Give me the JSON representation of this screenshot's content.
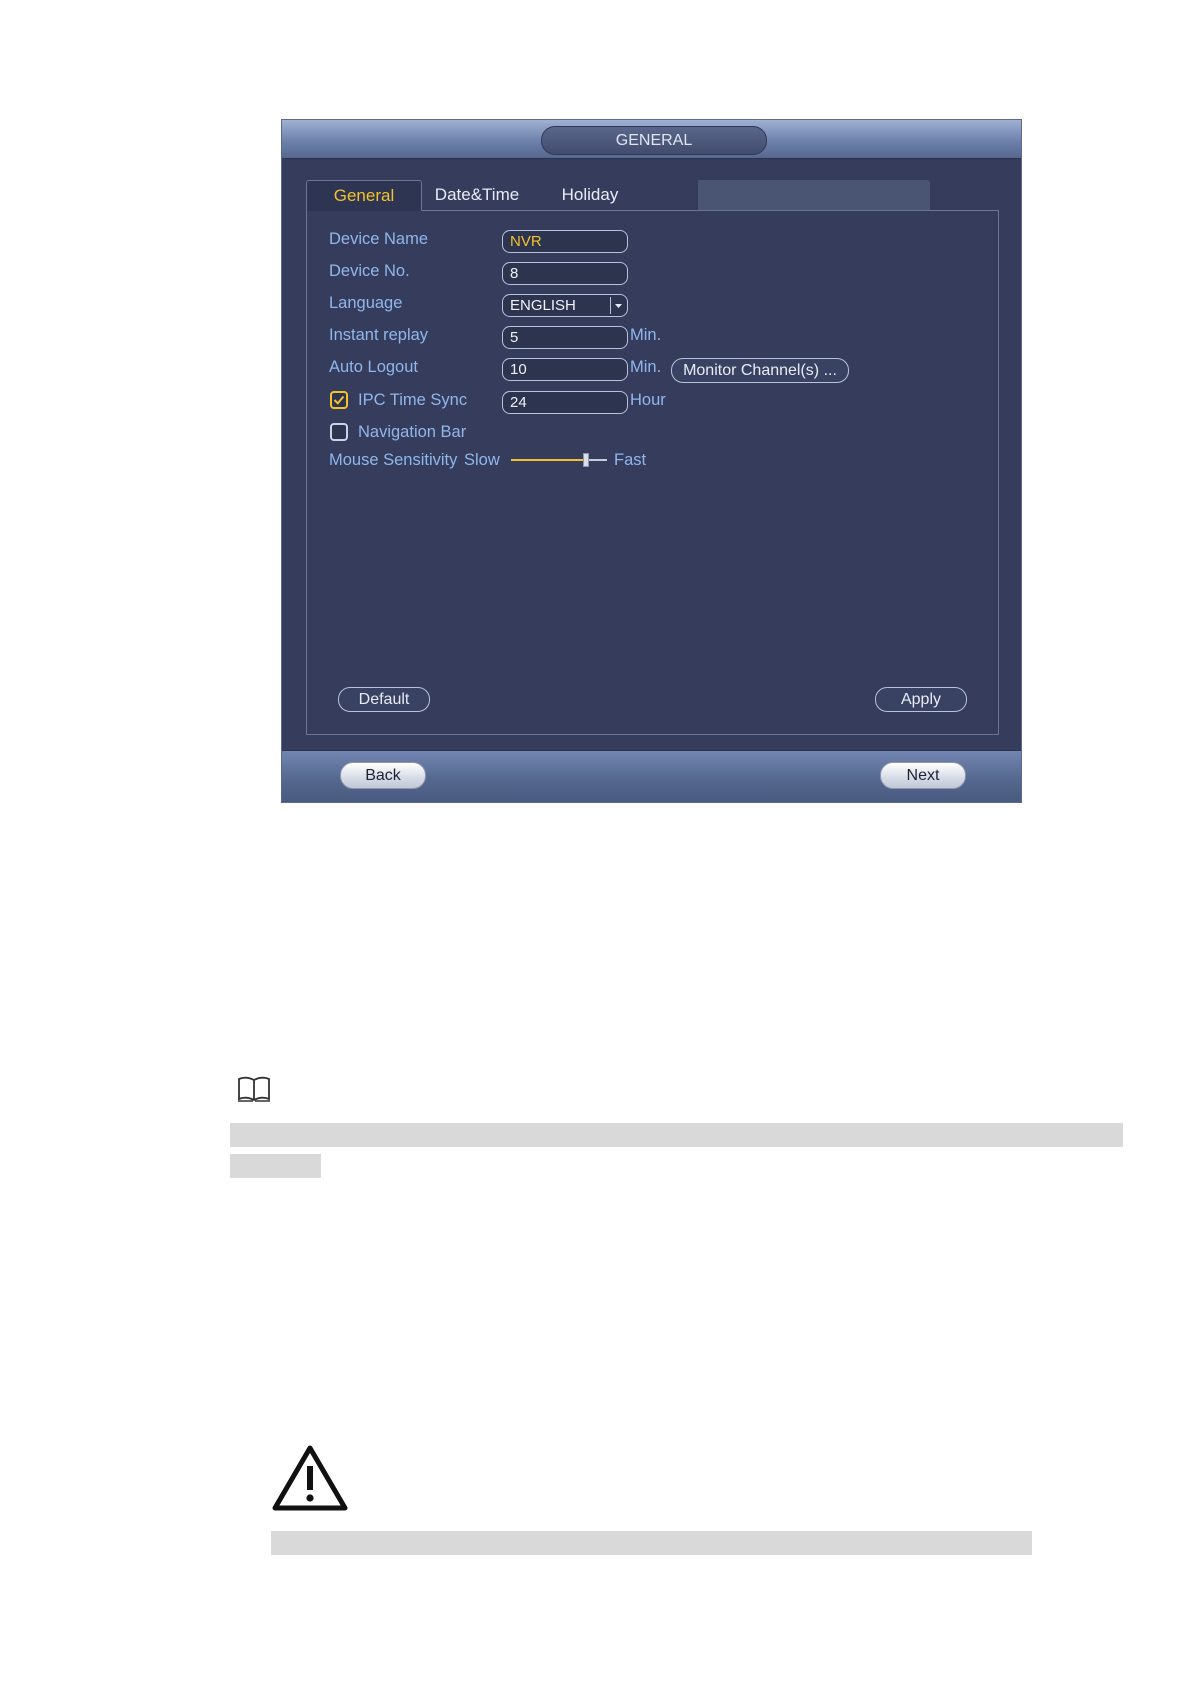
{
  "dialog": {
    "title": "GENERAL",
    "tabs": [
      {
        "label": "General",
        "active": true
      },
      {
        "label": "Date&Time",
        "active": false
      },
      {
        "label": "Holiday",
        "active": false
      }
    ],
    "fields": {
      "device_name": {
        "label": "Device Name",
        "value": "NVR"
      },
      "device_no": {
        "label": "Device No.",
        "value": "8"
      },
      "language": {
        "label": "Language",
        "value": "ENGLISH"
      },
      "instant_replay": {
        "label": "Instant replay",
        "value": "5",
        "unit": "Min."
      },
      "auto_logout": {
        "label": "Auto Logout",
        "value": "10",
        "unit": "Min.",
        "button": "Monitor Channel(s) ..."
      },
      "ipc_time_sync": {
        "label": "IPC Time Sync",
        "checked": true,
        "value": "24",
        "unit": "Hour"
      },
      "navigation_bar": {
        "label": "Navigation Bar",
        "checked": false
      },
      "mouse_sensitivity": {
        "label": "Mouse Sensitivity",
        "min_label": "Slow",
        "max_label": "Fast",
        "level": 0.78
      }
    },
    "buttons": {
      "default": "Default",
      "apply": "Apply",
      "back": "Back",
      "next": "Next"
    },
    "colors": {
      "accent": "#f2c22d",
      "label": "#8fb7ec",
      "panel": "#353c5c"
    }
  },
  "document": {
    "note_icon": "book-icon",
    "warning_icon": "warning-triangle-icon"
  }
}
